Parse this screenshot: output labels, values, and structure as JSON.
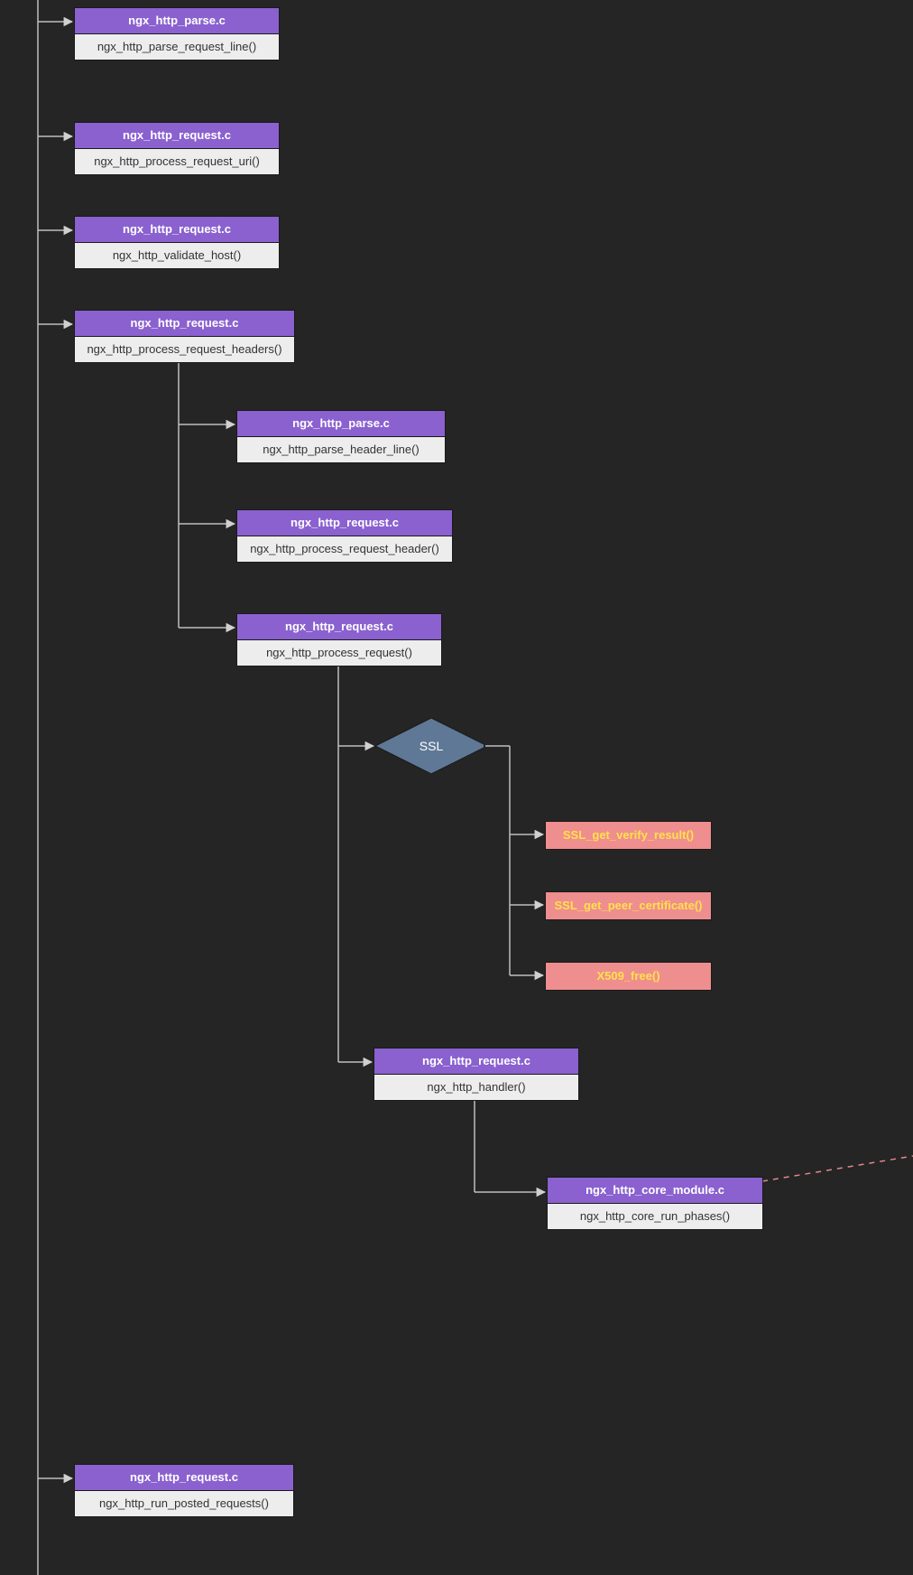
{
  "nodes": {
    "n1": {
      "header": "ngx_http_parse.c",
      "body": "ngx_http_parse_request_line()"
    },
    "n2": {
      "header": "ngx_http_request.c",
      "body": "ngx_http_process_request_uri()"
    },
    "n3": {
      "header": "ngx_http_request.c",
      "body": "ngx_http_validate_host()"
    },
    "n4": {
      "header": "ngx_http_request.c",
      "body": "ngx_http_process_request_headers()"
    },
    "n5": {
      "header": "ngx_http_parse.c",
      "body": "ngx_http_parse_header_line()"
    },
    "n6": {
      "header": "ngx_http_request.c",
      "body": "ngx_http_process_request_header()"
    },
    "n7": {
      "header": "ngx_http_request.c",
      "body": "ngx_http_process_request()"
    },
    "n8": {
      "header": "ngx_http_request.c",
      "body": "ngx_http_handler()"
    },
    "n9": {
      "header": "ngx_http_core_module.c",
      "body": "ngx_http_core_run_phases()"
    },
    "n10": {
      "header": "ngx_http_request.c",
      "body": "ngx_http_run_posted_requests()"
    },
    "ssl": {
      "label": "SSL"
    },
    "p1": {
      "label": "SSL_get_verify_result()"
    },
    "p2": {
      "label": "SSL_get_peer_certificate()"
    },
    "p3": {
      "label": "X509_free()"
    }
  }
}
